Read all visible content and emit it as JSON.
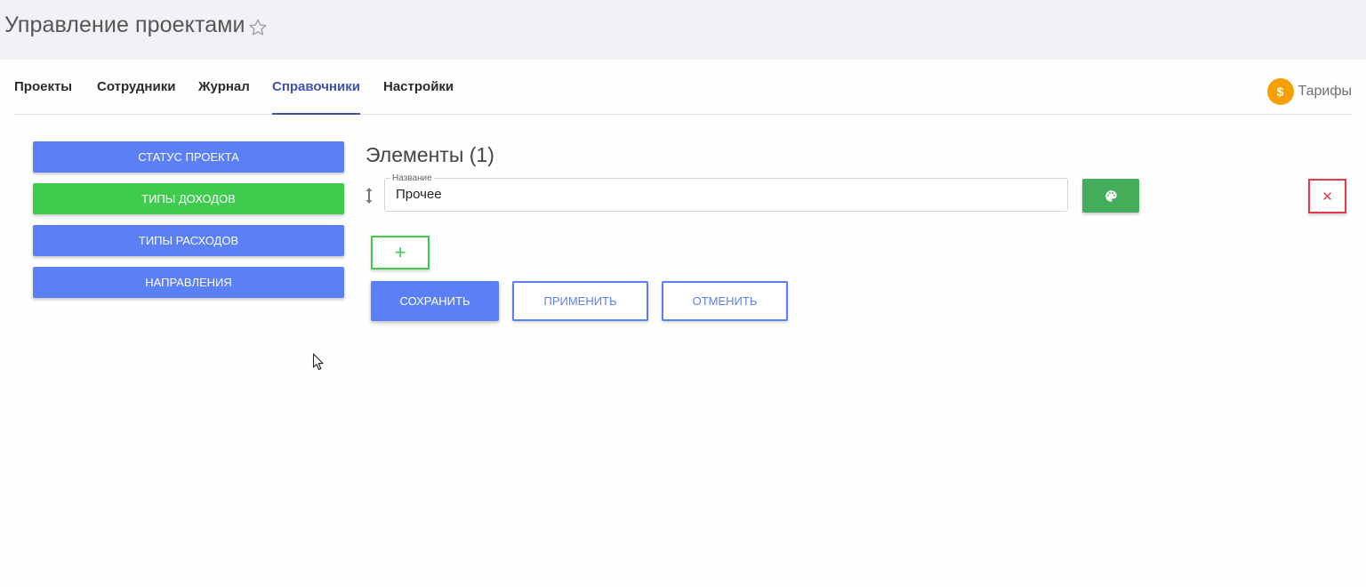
{
  "header": {
    "title": "Управление проектами",
    "favorite_icon": "star-outline-icon"
  },
  "nav": {
    "tabs": [
      {
        "label": "Проекты"
      },
      {
        "label": "Сотрудники"
      },
      {
        "label": "Журнал"
      },
      {
        "label": "Справочники",
        "active": true
      },
      {
        "label": "Настройки"
      }
    ],
    "tariffs": {
      "icon": "dollar-icon",
      "icon_glyph": "$",
      "label": "Тарифы",
      "color": "#f5a000"
    }
  },
  "sidebar": {
    "items": [
      {
        "label": "Статус проекта",
        "color": "#5b7ff4"
      },
      {
        "label": "Типы доходов",
        "color": "#3ecb4e",
        "active": true
      },
      {
        "label": "Типы расходов",
        "color": "#5b7ff4"
      },
      {
        "label": "Направления",
        "color": "#5b7ff4"
      }
    ]
  },
  "main": {
    "title": "Элементы (1)",
    "elements": [
      {
        "field_label": "Название",
        "value": "Прочее",
        "color_button_icon": "palette-icon",
        "delete_icon": "close-icon",
        "delete_glyph": "✕"
      }
    ],
    "add_glyph": "+",
    "actions": {
      "save": "Сохранить",
      "apply": "Применить",
      "cancel": "Отменить"
    }
  },
  "colors": {
    "accent": "#3f51b5",
    "primary": "#5b7ff4",
    "success": "#3ecb4e",
    "palette_button": "#44ad5a",
    "danger": "#e8394d"
  }
}
